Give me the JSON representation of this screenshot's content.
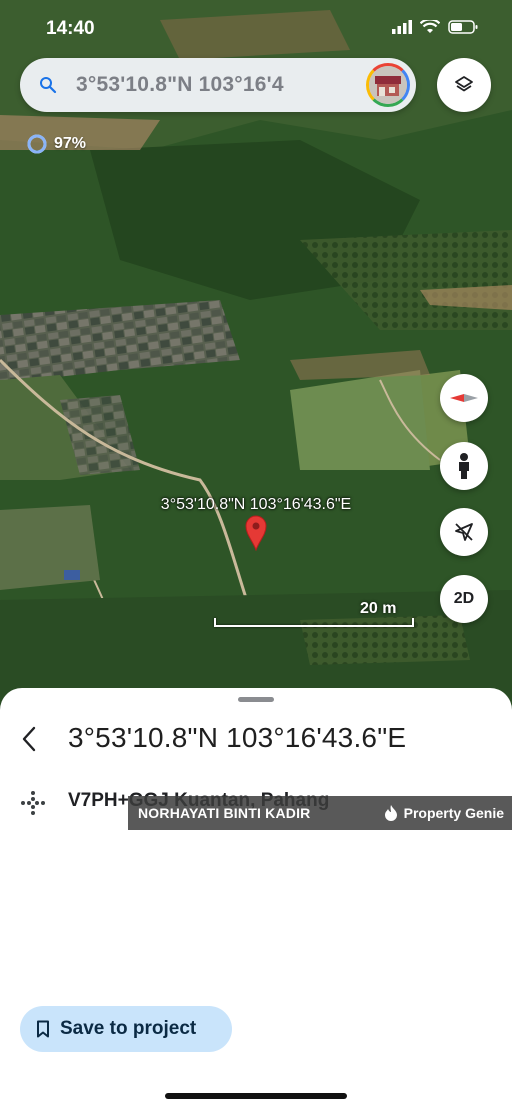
{
  "status_bar": {
    "time": "14:40"
  },
  "search": {
    "query": "3°53'10.8\"N 103°16'4"
  },
  "progress": {
    "text": "97%",
    "value": 0.97
  },
  "map": {
    "pin_label": "3°53'10.8\"N 103°16'43.6\"E",
    "scale_label": "20 m",
    "view_mode_label": "2D"
  },
  "sheet": {
    "title": "3°53'10.8\"N 103°16'43.6\"E",
    "plus_code": "V7PH+GGJ Kuantan, Pahang",
    "save_label": "Save to project"
  },
  "watermark": {
    "owner": "NORHAYATI BINTI KADIR",
    "brand": "Property Genie"
  },
  "colors": {
    "accent_light": "#c9e4fb",
    "pin_red": "#e53935",
    "progress_blue": "#8ab4f8"
  },
  "icons": [
    "search-icon",
    "layers-icon",
    "compass-icon",
    "street-view-icon",
    "location-off-icon",
    "chevron-left-icon",
    "plus-code-icon",
    "bookmark-icon",
    "flame-icon"
  ]
}
